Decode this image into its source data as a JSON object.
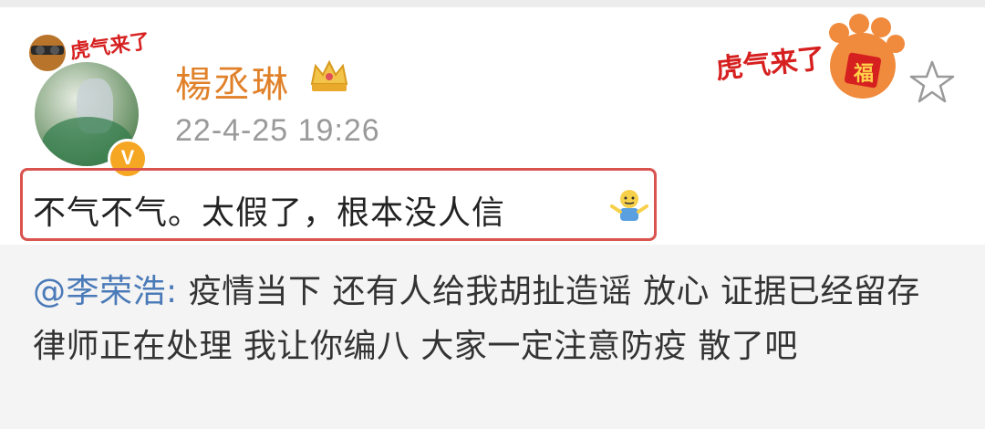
{
  "post": {
    "username": "楊丞琳",
    "timestamp": "22-4-25 19:26",
    "avatar_verified_badge": "V",
    "avatar_sticker_text": "虎气来了",
    "header_sticker_text": "虎气来了",
    "header_sticker_badge": "福",
    "content": "不气不气。太假了，根本没人信",
    "emoji": "shrug-emoji",
    "highlight_color": "#d9534f"
  },
  "repost": {
    "mention": "@李荣浩",
    "separator": ": ",
    "text": "疫情当下 还有人给我胡扯造谣 放心 证据已经留存 律师正在处理 我让你编八 大家一定注意防疫 散了吧"
  },
  "colors": {
    "username": "#e0812a",
    "mention": "#4a7ab8",
    "timestamp": "#9a9a9a",
    "repost_background": "#f4f4f4"
  }
}
